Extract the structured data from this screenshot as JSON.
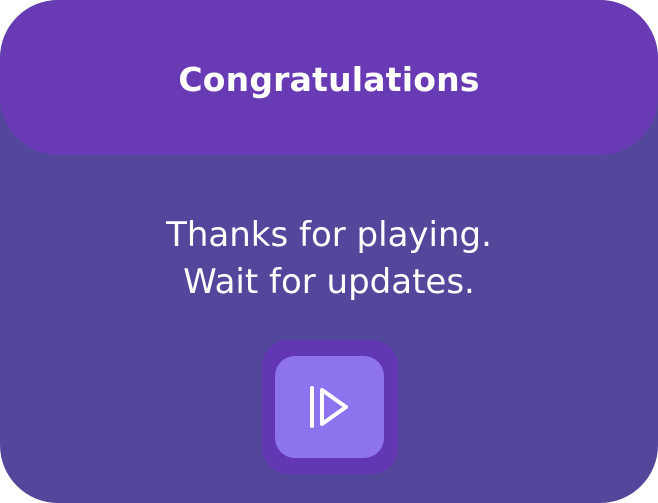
{
  "dialog": {
    "title": "Congratulations",
    "message_line_1": "Thanks for playing.",
    "message_line_2": "Wait for updates.",
    "play_button": {
      "icon": "play-icon"
    }
  },
  "colors": {
    "panel_background": "#52479a",
    "header_background": "#683bb5",
    "button_outer": "#6336b4",
    "button_inner": "#8e73ef",
    "text": "#ffffff"
  }
}
